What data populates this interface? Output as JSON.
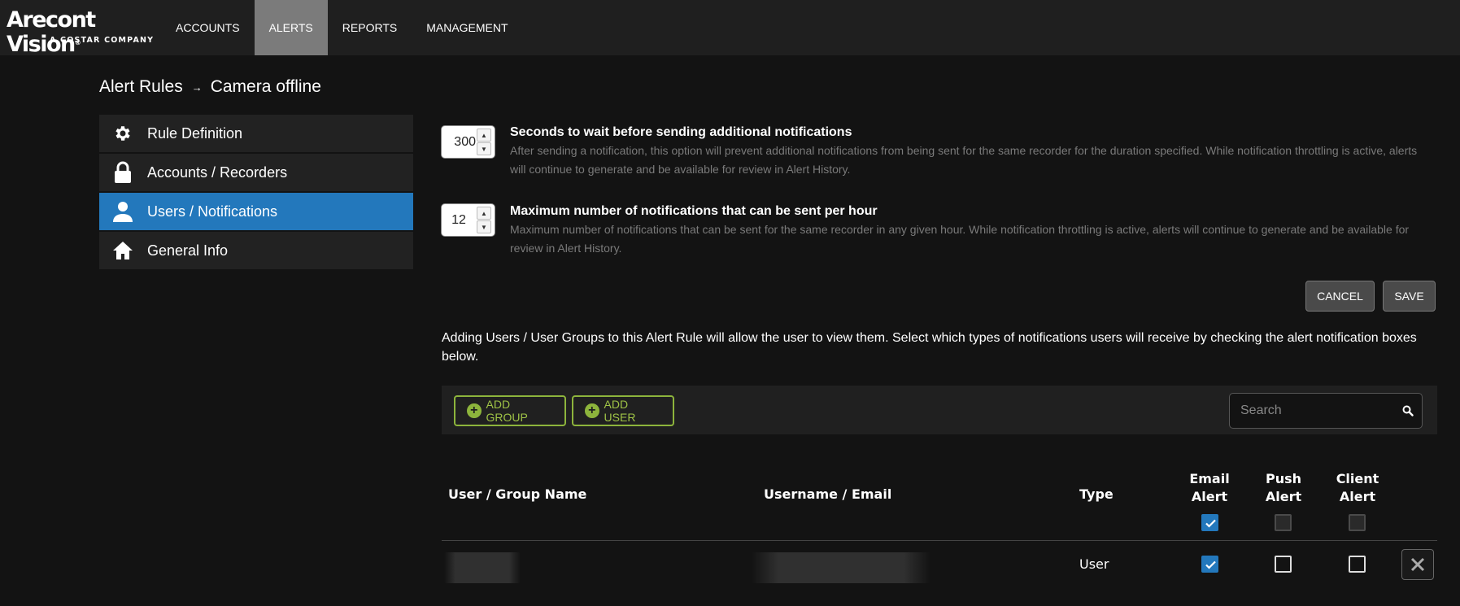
{
  "brand": {
    "name": "Arecont Vision",
    "registered": "®",
    "tagline": "A COSTAR COMPANY"
  },
  "nav": {
    "items": [
      {
        "label": "ACCOUNTS",
        "active": false
      },
      {
        "label": "ALERTS",
        "active": true
      },
      {
        "label": "REPORTS",
        "active": false
      },
      {
        "label": "MANAGEMENT",
        "active": false
      }
    ]
  },
  "breadcrumb": {
    "parent": "Alert Rules",
    "separator": "→",
    "current": "Camera offline"
  },
  "sidebar": {
    "items": [
      {
        "label": "Rule Definition",
        "icon": "gear-icon",
        "active": false
      },
      {
        "label": "Accounts / Recorders",
        "icon": "lock-icon",
        "active": false
      },
      {
        "label": "Users / Notifications",
        "icon": "user-icon",
        "active": true
      },
      {
        "label": "General Info",
        "icon": "home-icon",
        "active": false
      }
    ]
  },
  "settings": {
    "wait_seconds": {
      "value": "300",
      "title": "Seconds to wait before sending additional notifications",
      "description": "After sending a notification, this option will prevent additional notifications from being sent for the same recorder for the duration specified. While notification throttling is active, alerts will continue to generate and be available for review in Alert History."
    },
    "max_per_hour": {
      "value": "12",
      "title": "Maximum number of notifications that can be sent per hour",
      "description": "Maximum number of notifications that can be sent for the same recorder in any given hour. While notification throttling is active, alerts will continue to generate and be available for review in Alert History."
    }
  },
  "actions": {
    "cancel": "CANCEL",
    "save": "SAVE"
  },
  "info_text": "Adding Users / User Groups to this Alert Rule will allow the user to view them. Select which types of notifications users will receive by checking the alert notification boxes below.",
  "toolbar": {
    "add_group": "ADD GROUP",
    "add_user": "ADD USER",
    "search_placeholder": "Search"
  },
  "table": {
    "columns": {
      "name": "User / Group Name",
      "username": "Username / Email",
      "type": "Type",
      "email_line1": "Email",
      "email_line2": "Alert",
      "push_line1": "Push",
      "push_line2": "Alert",
      "client_line1": "Client",
      "client_line2": "Alert"
    },
    "header_checks": {
      "email": true,
      "push": false,
      "client": false
    },
    "rows": [
      {
        "name": "",
        "username": "",
        "type": "User",
        "email": true,
        "push": false,
        "client": false
      }
    ]
  },
  "colors": {
    "accent": "#2378bc",
    "add_green": "#8db43c",
    "nav_active": "#7b7b7b"
  }
}
